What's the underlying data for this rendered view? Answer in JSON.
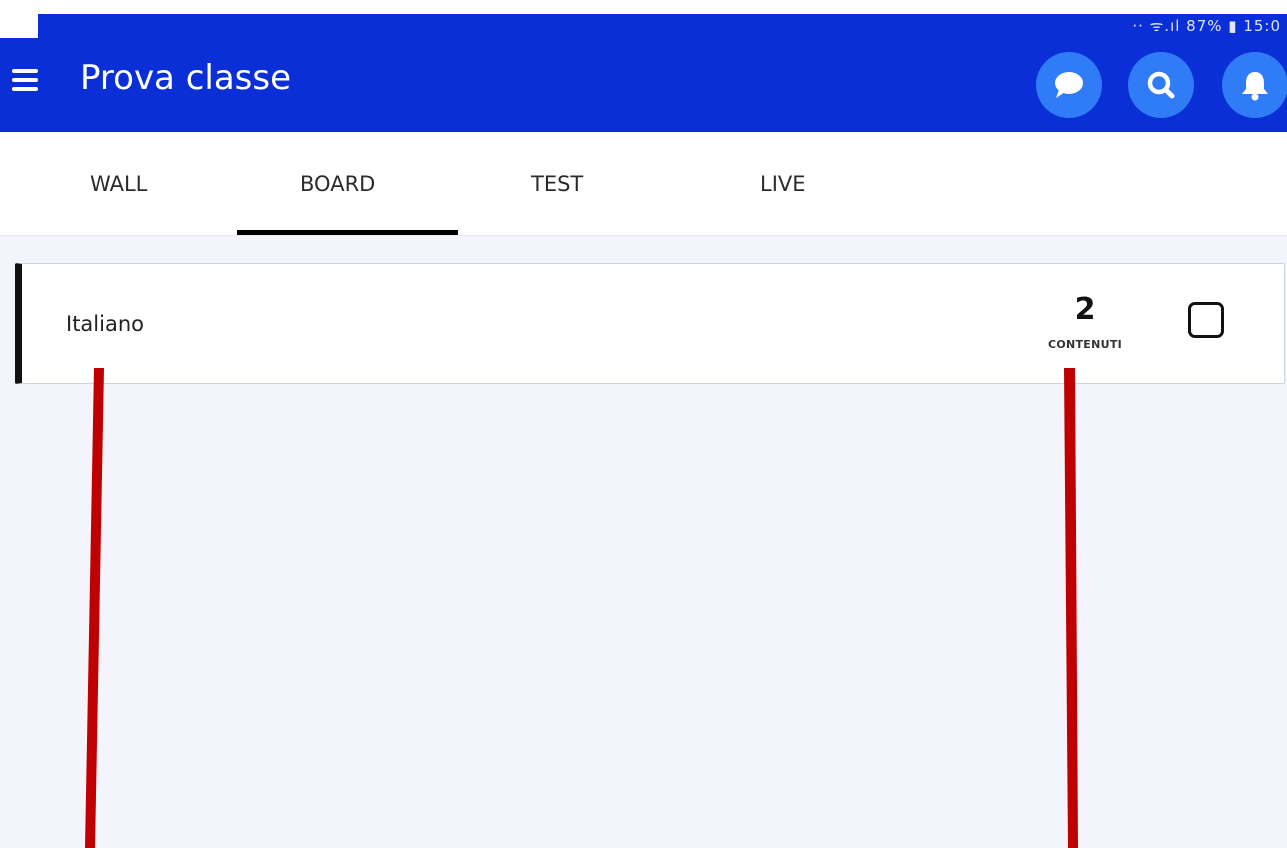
{
  "status_bar": {
    "text": "·· ᯤ.ıl 87% ▮ 15:0"
  },
  "app_bar": {
    "title": "Prova classe",
    "menu_icon": "hamburger-menu-icon",
    "actions": [
      {
        "name": "chat",
        "icon": "chat-bubble-icon"
      },
      {
        "name": "search",
        "icon": "search-icon"
      },
      {
        "name": "notifications",
        "icon": "bell-icon"
      }
    ]
  },
  "tabs": {
    "items": [
      {
        "label": "WALL"
      },
      {
        "label": "BOARD"
      },
      {
        "label": "TEST"
      },
      {
        "label": "LIVE"
      }
    ],
    "selected": "BOARD"
  },
  "board": {
    "items": [
      {
        "title": "Italiano",
        "count": "2",
        "count_label": "CONTENUTI",
        "checked": false
      }
    ]
  },
  "colors": {
    "app_bar": "#0a2fd6",
    "icon_circle": "#2f7cf6",
    "content_background": "#f3f4fc",
    "annotation_marker": "#c00000"
  }
}
